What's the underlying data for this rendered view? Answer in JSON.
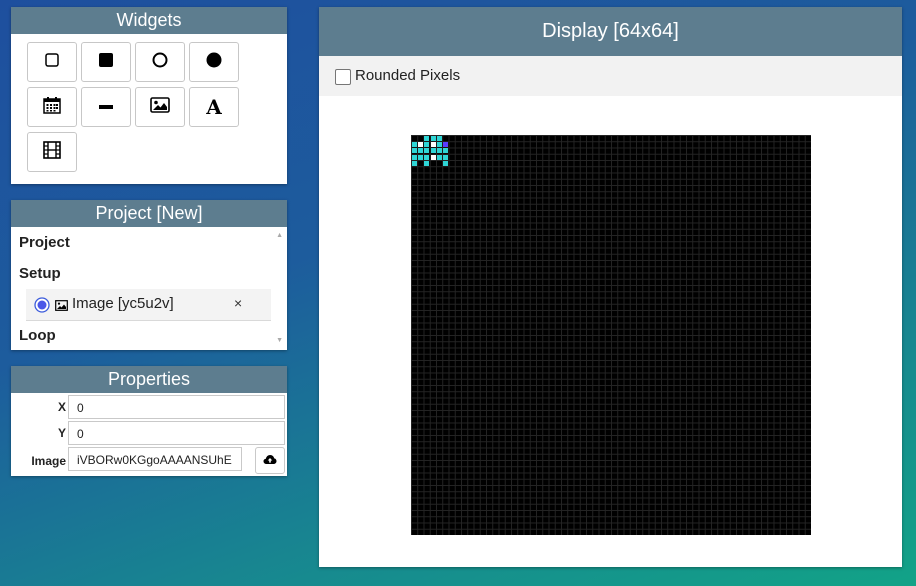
{
  "widgets": {
    "title": "Widgets",
    "buttons": [
      {
        "name": "rect-outline",
        "icon": "square-outline-icon"
      },
      {
        "name": "rect-filled",
        "icon": "square-filled-icon"
      },
      {
        "name": "circle-outline",
        "icon": "circle-outline-icon"
      },
      {
        "name": "circle-filled",
        "icon": "circle-filled-icon"
      },
      {
        "name": "calendar",
        "icon": "calendar-icon"
      },
      {
        "name": "line",
        "icon": "line-icon"
      },
      {
        "name": "image",
        "icon": "image-icon"
      },
      {
        "name": "text",
        "icon": "text-icon"
      },
      {
        "name": "animation",
        "icon": "film-icon"
      }
    ]
  },
  "project": {
    "title": "Project [New]",
    "section_project": "Project",
    "section_setup": "Setup",
    "section_loop": "Loop",
    "item": {
      "label": "Image [yc5u2v]",
      "delete": "×"
    }
  },
  "properties": {
    "title": "Properties",
    "x_label": "X",
    "x_value": "0",
    "y_label": "Y",
    "y_value": "0",
    "image_label": "Image",
    "image_value": "iVBORw0KGgoAAAANSUhE"
  },
  "display": {
    "title": "Display [64x64]",
    "rounded_label": "Rounded Pixels",
    "rounded_checked": false,
    "pixel_colors": {
      "cyan": "#2fd6d6",
      "white": "#ffffff",
      "blue": "#5a3cff"
    },
    "pixels": [
      "..ccc.",
      "cwcwcb",
      "cccccc",
      "cccwcc",
      "c.c..c"
    ]
  }
}
